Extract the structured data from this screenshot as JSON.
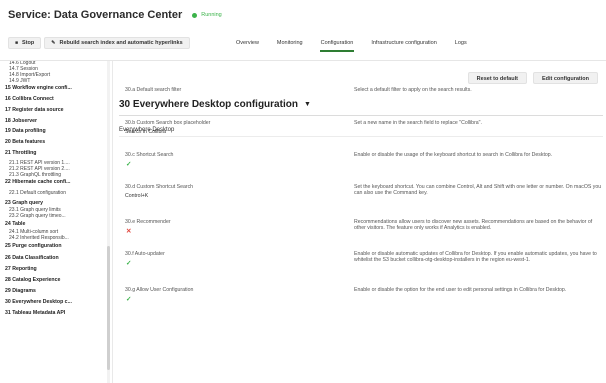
{
  "header": {
    "title": "Service: Data Governance Center",
    "status": "Running",
    "toolbar": {
      "stop_label": "Stop",
      "rebuild_label": "Rebuild search index and automatic hyperlinks"
    },
    "tabs": [
      "Overview",
      "Monitoring",
      "Configuration",
      "Infrastructure configuration",
      "Logs"
    ],
    "active_tab": "Configuration"
  },
  "sidebar": {
    "items": [
      {
        "text": "14.6 Logout",
        "kind": "sub"
      },
      {
        "text": "14.7 Session",
        "kind": "sub"
      },
      {
        "text": "14.8 Import/Export",
        "kind": "sub"
      },
      {
        "text": "14.9 JWT",
        "kind": "sub"
      },
      {
        "text": "15 Workflow engine confi...",
        "kind": "top"
      },
      {
        "text": "16 Collibra Connect",
        "kind": "top"
      },
      {
        "text": "17 Register data source",
        "kind": "top"
      },
      {
        "text": "18 Jobserver",
        "kind": "top"
      },
      {
        "text": "19 Data profiling",
        "kind": "top"
      },
      {
        "text": "20 Beta features",
        "kind": "top"
      },
      {
        "text": "21 Throttling",
        "kind": "top"
      },
      {
        "text": "21.1 REST API version 1....",
        "kind": "sub"
      },
      {
        "text": "21.2 REST API version 2....",
        "kind": "sub"
      },
      {
        "text": "21.3 GraphQL throttling",
        "kind": "sub"
      },
      {
        "text": "22 Hibernate cache confi...",
        "kind": "top"
      },
      {
        "text": "22.1 Default configuration",
        "kind": "sub"
      },
      {
        "text": "23 Graph query",
        "kind": "top"
      },
      {
        "text": "23.1 Graph query limits",
        "kind": "sub"
      },
      {
        "text": "23.2 Graph query timeo...",
        "kind": "sub"
      },
      {
        "text": "24 Table",
        "kind": "top"
      },
      {
        "text": "24.1 Multi-column sort",
        "kind": "sub"
      },
      {
        "text": "24.2 Inherited Responsib...",
        "kind": "sub"
      },
      {
        "text": "25 Purge configuration",
        "kind": "top"
      },
      {
        "text": "26 Data Classification",
        "kind": "top"
      },
      {
        "text": "27 Reporting",
        "kind": "top"
      },
      {
        "text": "28 Catalog Experience",
        "kind": "top"
      },
      {
        "text": "29 Diagrams",
        "kind": "top"
      },
      {
        "text": "30 Everywhere Desktop c...",
        "kind": "top"
      },
      {
        "text": "31 Tableau Metadata API",
        "kind": "top"
      }
    ]
  },
  "main": {
    "reset_label": "Reset to default",
    "edit_label": "Edit configuration",
    "page_title": "30 Everywhere Desktop configuration",
    "section_title": "Everywhere Desktop",
    "settings": [
      {
        "label": "30.a Default search filter",
        "value": "",
        "state": "",
        "desc": "Select a default filter to apply on the search results."
      },
      {
        "label": "30.b Custom Search box placeholder",
        "value": "Search in Collibra",
        "state": "",
        "desc": "Set a new name in the search field to replace \"Collibra\"."
      },
      {
        "label": "30.c Shortcut Search",
        "value": "",
        "state": "check",
        "desc": "Enable or disable the usage of the keyboard shortcut to search in Collibra for Desktop."
      },
      {
        "label": "30.d Custom Shortcut Search",
        "value": "Control+K",
        "state": "",
        "desc": "Set the keyboard shortcut. You can combine Control, Alt and Shift with one letter or number. On macOS you can also use the Command key."
      },
      {
        "label": "30.e Recommender",
        "value": "",
        "state": "cross",
        "desc": "Recommendations allow users to discover new assets. Recommendations are based on the behavior of other visitors. The feature only works if Analytics is enabled."
      },
      {
        "label": "30.f Auto-updater",
        "value": "",
        "state": "check",
        "desc": "Enable or disable automatic updates of Collibra for Desktop. If you enable automatic updates, you have to whitelist the S3 bucket collibra-otg-desktop-installers in the region eu-west-1."
      },
      {
        "label": "30.g Allow User Configuration",
        "value": "",
        "state": "check",
        "desc": "Enable or disable the option for the end user to edit personal settings in Collibra for Desktop."
      }
    ]
  },
  "colors": {
    "accent_green": "#3bb34a",
    "active_tab_underline": "#2e7d32",
    "cross_red": "#e0443b"
  }
}
